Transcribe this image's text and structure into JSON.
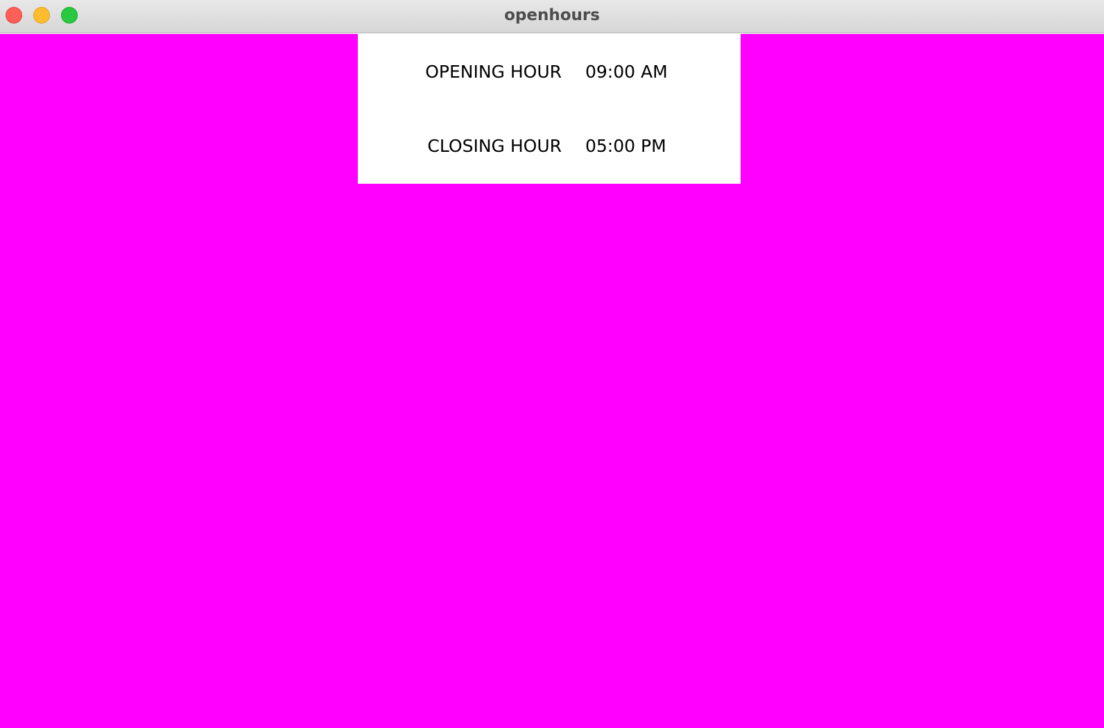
{
  "window": {
    "title": "openhours",
    "background_color": "#ff00ff",
    "controls": [
      "close-icon",
      "minimize-icon",
      "maximize-icon"
    ]
  },
  "hours": {
    "opening": {
      "label": "OPENING HOUR",
      "value": "09:00 AM"
    },
    "closing": {
      "label": "CLOSING HOUR",
      "value": "05:00 PM"
    }
  }
}
